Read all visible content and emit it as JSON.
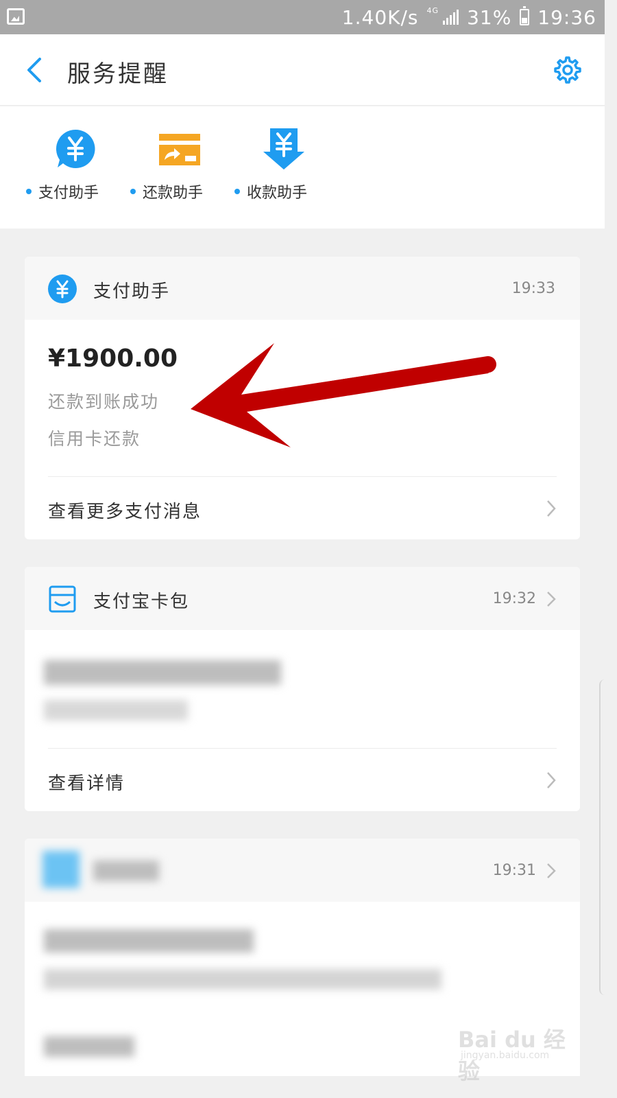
{
  "status_bar": {
    "speed": "1.40K/s",
    "network": "4G",
    "battery": "31%",
    "time": "19:36"
  },
  "header": {
    "title": "服务提醒"
  },
  "quick_entries": [
    {
      "label": "支付助手",
      "icon": "yuan-bubble-icon"
    },
    {
      "label": "还款助手",
      "icon": "card-repay-icon"
    },
    {
      "label": "收款助手",
      "icon": "yuan-arrow-down-icon"
    }
  ],
  "cards": {
    "payment": {
      "title": "支付助手",
      "time": "19:33",
      "amount": "¥1900.00",
      "line1": "还款到账成功",
      "line2": "信用卡还款",
      "link": "查看更多支付消息"
    },
    "wallet": {
      "title": "支付宝卡包",
      "time": "19:32",
      "link": "查看详情"
    },
    "third": {
      "time": "19:31"
    }
  },
  "colors": {
    "accent": "#1f9cf0",
    "repay_orange": "#f5a623",
    "annotation_red": "#c00000"
  },
  "watermark": {
    "logo": "Bai du 经验",
    "url": "jingyan.baidu.com"
  }
}
